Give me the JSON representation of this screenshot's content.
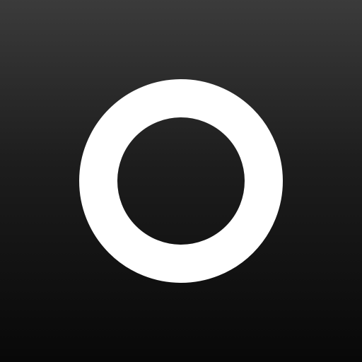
{
  "app_icon": {
    "icon_name": "ring-icon",
    "colors": {
      "background_top": "#3b3b3b",
      "background_bottom": "#080808",
      "ring": "#ffffff"
    }
  }
}
